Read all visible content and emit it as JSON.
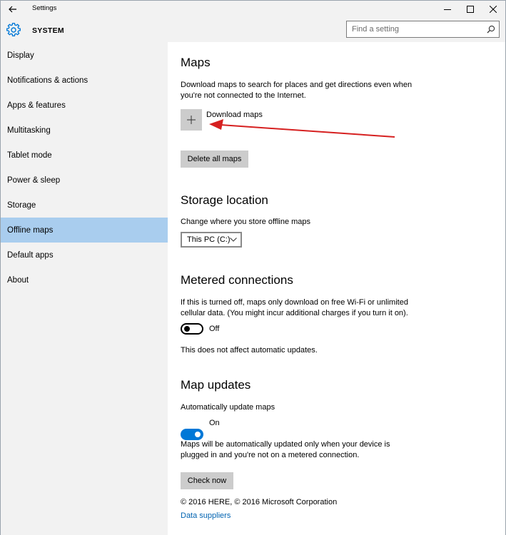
{
  "window": {
    "title": "Settings",
    "section_title": "SYSTEM",
    "controls": [
      "minimize",
      "maximize",
      "close"
    ]
  },
  "search": {
    "placeholder": "Find a setting"
  },
  "sidebar": {
    "items": [
      {
        "label": "Display"
      },
      {
        "label": "Notifications & actions"
      },
      {
        "label": "Apps & features"
      },
      {
        "label": "Multitasking"
      },
      {
        "label": "Tablet mode"
      },
      {
        "label": "Power & sleep"
      },
      {
        "label": "Storage"
      },
      {
        "label": "Offline maps",
        "selected": true
      },
      {
        "label": "Default apps"
      },
      {
        "label": "About"
      }
    ]
  },
  "maps": {
    "title": "Maps",
    "description_line1": "Download maps to search for places and get directions even when",
    "description_line2": "you're not connected to the Internet.",
    "download_label": "Download maps",
    "delete_button": "Delete all maps"
  },
  "storage": {
    "title": "Storage location",
    "description": "Change where you store offline maps",
    "selected_drive": "This PC (C:)"
  },
  "metered": {
    "title": "Metered connections",
    "description_line1": "If this is turned off, maps only download on free Wi-Fi or unlimited",
    "description_line2": "cellular data. (You might incur additional charges if you turn it on).",
    "toggle_state": "Off",
    "note": "This does not affect automatic updates."
  },
  "updates": {
    "title": "Map updates",
    "auto_label": "Automatically update maps",
    "toggle_state": "On",
    "description_line1": "Maps will be automatically updated only when your device is",
    "description_line2": "plugged in and you're not on a metered connection.",
    "check_button": "Check now"
  },
  "footer": {
    "copyright": "© 2016 HERE, © 2016 Microsoft Corporation",
    "link": "Data suppliers"
  },
  "colors": {
    "accent": "#0078d7",
    "selected_nav": "#a9cdee",
    "annotation_arrow": "#d62020"
  }
}
